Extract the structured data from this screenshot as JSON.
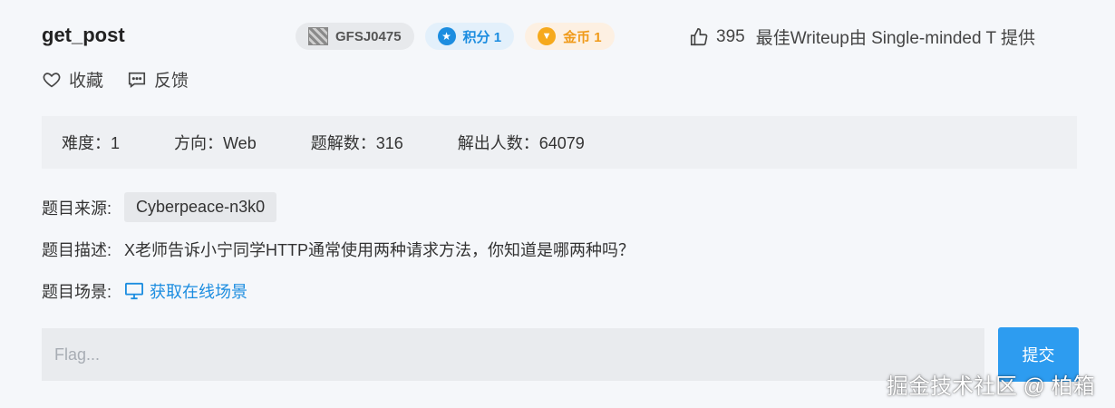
{
  "challenge": {
    "title": "get_post",
    "badges": {
      "id": "GFSJ0475",
      "score": "积分 1",
      "coin": "金币 1"
    },
    "likes": "395",
    "writeup_credit": "最佳Writeup由 Single-minded T 提供",
    "favorite_label": "收藏",
    "feedback_label": "反馈"
  },
  "info": {
    "difficulty": "难度：1",
    "direction": "方向：Web",
    "solves": "题解数：316",
    "solvers": "解出人数：64079"
  },
  "details": {
    "source_label": "题目来源:",
    "source_value": "Cyberpeace-n3k0",
    "desc_label": "题目描述:",
    "desc_value": "X老师告诉小宁同学HTTP通常使用两种请求方法，你知道是哪两种吗？",
    "scene_label": "题目场景:",
    "scene_link": "获取在线场景"
  },
  "flag": {
    "placeholder": "Flag...",
    "submit_label": "提交"
  },
  "watermark": "掘金技术社区 @ 柏箱",
  "colors": {
    "accent": "#2d9cf0",
    "coin": "#f09a1a",
    "background": "#f5f7fa"
  }
}
